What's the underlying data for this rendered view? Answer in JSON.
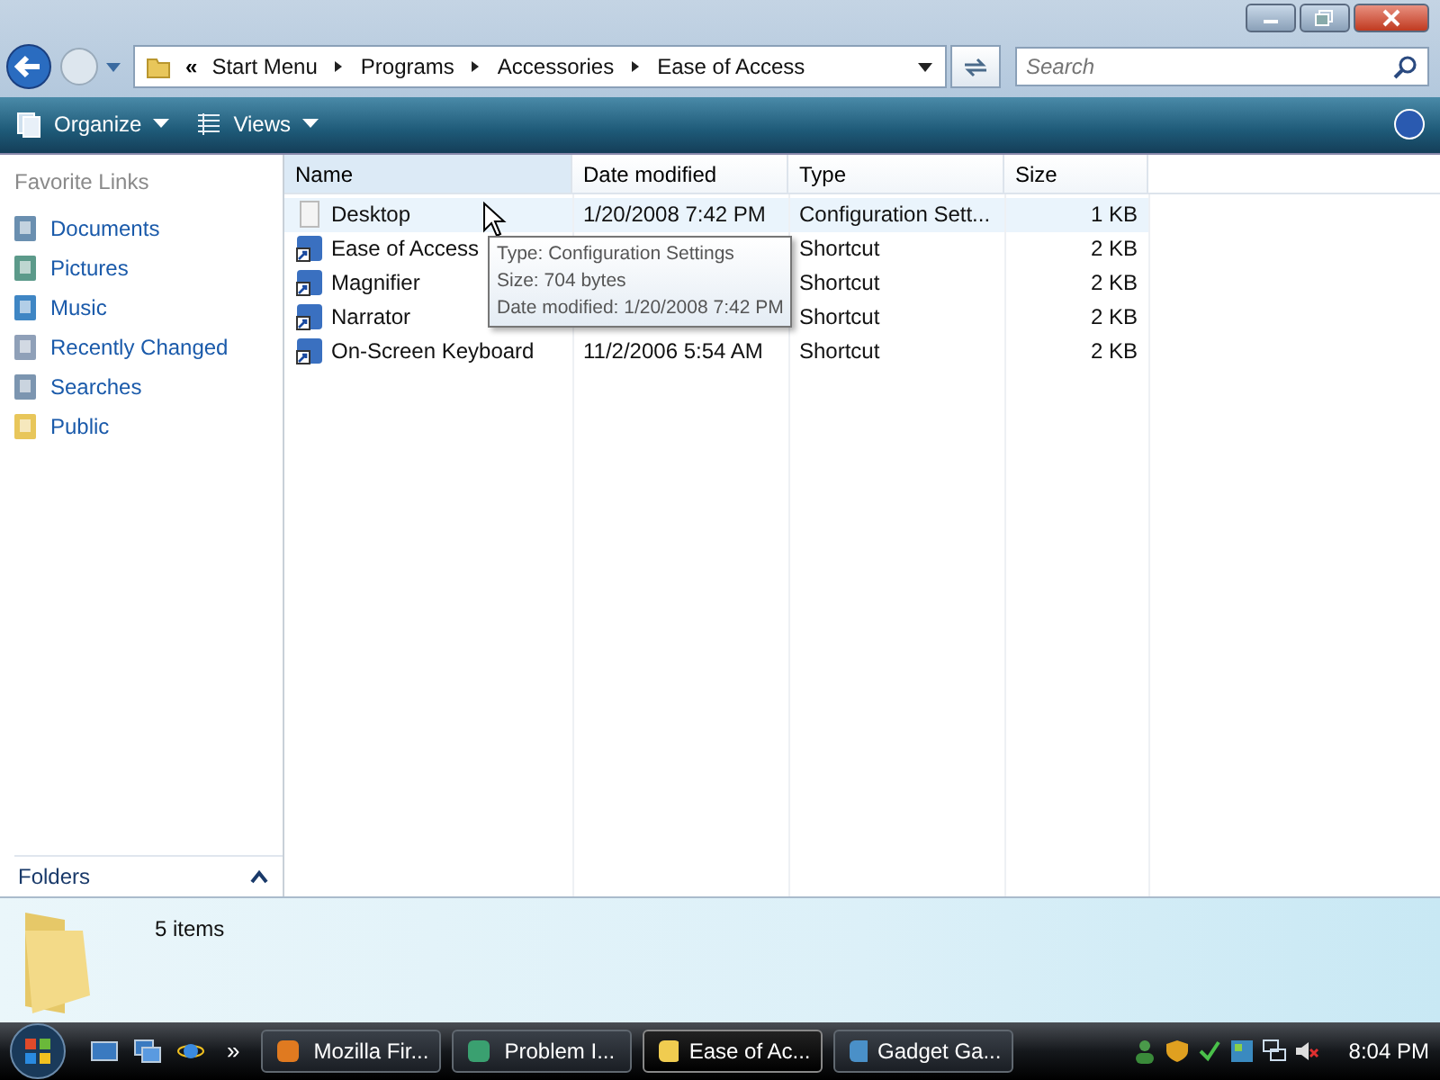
{
  "address": {
    "prefix": "«",
    "crumbs": [
      "Start Menu",
      "Programs",
      "Accessories",
      "Ease of Access"
    ]
  },
  "search": {
    "placeholder": "Search"
  },
  "toolbar": [
    "Organize",
    "Views"
  ],
  "sidebar": {
    "heading": "Favorite Links",
    "items": [
      {
        "label": "Documents",
        "kind": "documents"
      },
      {
        "label": "Pictures",
        "kind": "pictures"
      },
      {
        "label": "Music",
        "kind": "music"
      },
      {
        "label": "Recently Changed",
        "kind": "recent"
      },
      {
        "label": "Searches",
        "kind": "searches"
      },
      {
        "label": "Public",
        "kind": "folder"
      }
    ],
    "folders": "Folders"
  },
  "table": {
    "columns": [
      "Name",
      "Date modified",
      "Type",
      "Size"
    ],
    "rows": [
      {
        "name": "Desktop",
        "date": "1/20/2008 7:42 PM",
        "type": "Configuration Sett...",
        "size": "1 KB",
        "highlighted": true,
        "kind": "settings"
      },
      {
        "name": "Ease of Access",
        "date": "",
        "type": "Shortcut",
        "size": "2 KB",
        "highlighted": false,
        "kind": "shortcut"
      },
      {
        "name": "Magnifier",
        "date": "",
        "type": "Shortcut",
        "size": "2 KB",
        "highlighted": false,
        "kind": "shortcut"
      },
      {
        "name": "Narrator",
        "date": "",
        "type": "Shortcut",
        "size": "2 KB",
        "highlighted": false,
        "kind": "shortcut"
      },
      {
        "name": "On-Screen Keyboard",
        "date": "11/2/2006 5:54 AM",
        "type": "Shortcut",
        "size": "2 KB",
        "highlighted": false,
        "kind": "shortcut"
      }
    ]
  },
  "tooltip": [
    "Type: Configuration Settings",
    "Size: 704 bytes",
    "Date modified: 1/20/2008 7:42 PM"
  ],
  "details": "5 items",
  "taskbar": {
    "more": "»",
    "buttons": [
      {
        "label": "Mozilla Fir...",
        "selected": false,
        "kind": "firefox"
      },
      {
        "label": "Problem I...",
        "selected": false,
        "kind": "problem"
      },
      {
        "label": "Ease of Ac...",
        "selected": true,
        "kind": "folder"
      },
      {
        "label": "Gadget Ga...",
        "selected": false,
        "kind": "gadget"
      }
    ],
    "time": "8:04 PM"
  }
}
